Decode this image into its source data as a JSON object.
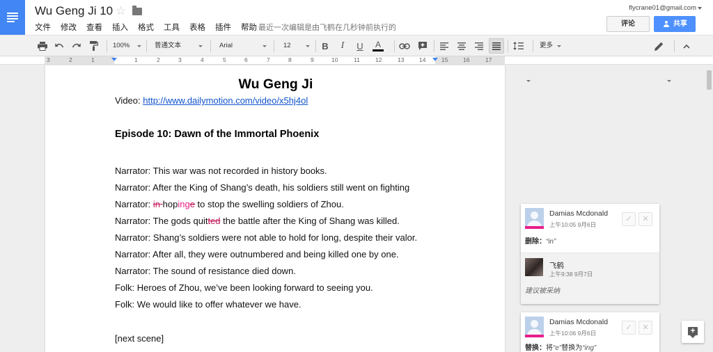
{
  "header": {
    "title": "Wu Geng Ji 10",
    "menu": [
      "文件",
      "修改",
      "查看",
      "插入",
      "格式",
      "工具",
      "表格",
      "插件",
      "帮助"
    ],
    "last_edit": "最近一次编辑是由飞鹤在几秒钟前执行的",
    "account_email": "flycrane01@gmail.com",
    "comment_label": "评论",
    "share_label": "共享",
    "accent_color": "#4d90fe"
  },
  "toolbar": {
    "zoom": "100%",
    "style": "普通文本",
    "font": "Arial",
    "size": "12",
    "more_label": "更多",
    "icons": [
      "print-icon",
      "undo-icon",
      "redo-icon",
      "paint-format-icon",
      "bold-icon",
      "italic-icon",
      "underline-icon",
      "text-color-icon",
      "link-icon",
      "insert-comment-icon",
      "align-left-icon",
      "align-center-icon",
      "align-right-icon",
      "align-justify-icon",
      "line-spacing-icon",
      "pencil-icon",
      "collapse-icon"
    ]
  },
  "ruler": {
    "numbers": [
      "3",
      "2",
      "1",
      "1",
      "2",
      "3",
      "4",
      "5",
      "6",
      "7",
      "8",
      "9",
      "10",
      "11",
      "12",
      "13",
      "14",
      "15",
      "16",
      "17"
    ]
  },
  "document": {
    "heading": "Wu Geng Ji",
    "video_label": "Video: ",
    "video_link": "http://www.dailymotion.com/video/x5hj4ol",
    "episode": "Episode 10: Dawn of the Immortal Phoenix",
    "line_prefix": "Narrator: ",
    "lines": {
      "l1": "Narrator: This war was not recorded in history books.",
      "l2": "Narrator: After the King of Shang’s death, his soldiers still went on fighting",
      "l3_a": "Narrator: ",
      "l3_del1": "in ",
      "l3_b": "hop",
      "l3_ins": "ing",
      "l3_del2": "e",
      "l3_c": " to stop the swelling soldiers of Zhou.",
      "l4_a": "Narrator: The gods quit",
      "l4_del": "ted",
      "l4_b": " the battle after the King of Shang was killed.",
      "l5": "Narrator: Shang’s soldiers were not able to hold for long, despite their valor.",
      "l6": "Narrator: After all, they were outnumbered and being killed one by one.",
      "l7": "Narrator: The sound of resistance died down.",
      "l8": "Folk: Heroes of Zhou, we’ve been looking forward to seeing you.",
      "l9": "Folk: We would like to offer whatever we have.",
      "l10": "[next scene]"
    },
    "suggestion_color": "#e91e8c"
  },
  "comments": [
    {
      "author": "Damias Mcdonald",
      "time": "上午10:05 9月6日",
      "action": "删除：",
      "detail": "“in”",
      "reply_author": "飞鹤",
      "reply_time": "上午9:38 9月7日",
      "reply_text": "建议被采纳"
    },
    {
      "author": "Damias Mcdonald",
      "time": "上午10:06 9月6日",
      "action": "替换：",
      "detail_a": "将",
      "detail_b": "“e”",
      "detail_c": "替换为",
      "detail_d": "“ing”"
    }
  ]
}
